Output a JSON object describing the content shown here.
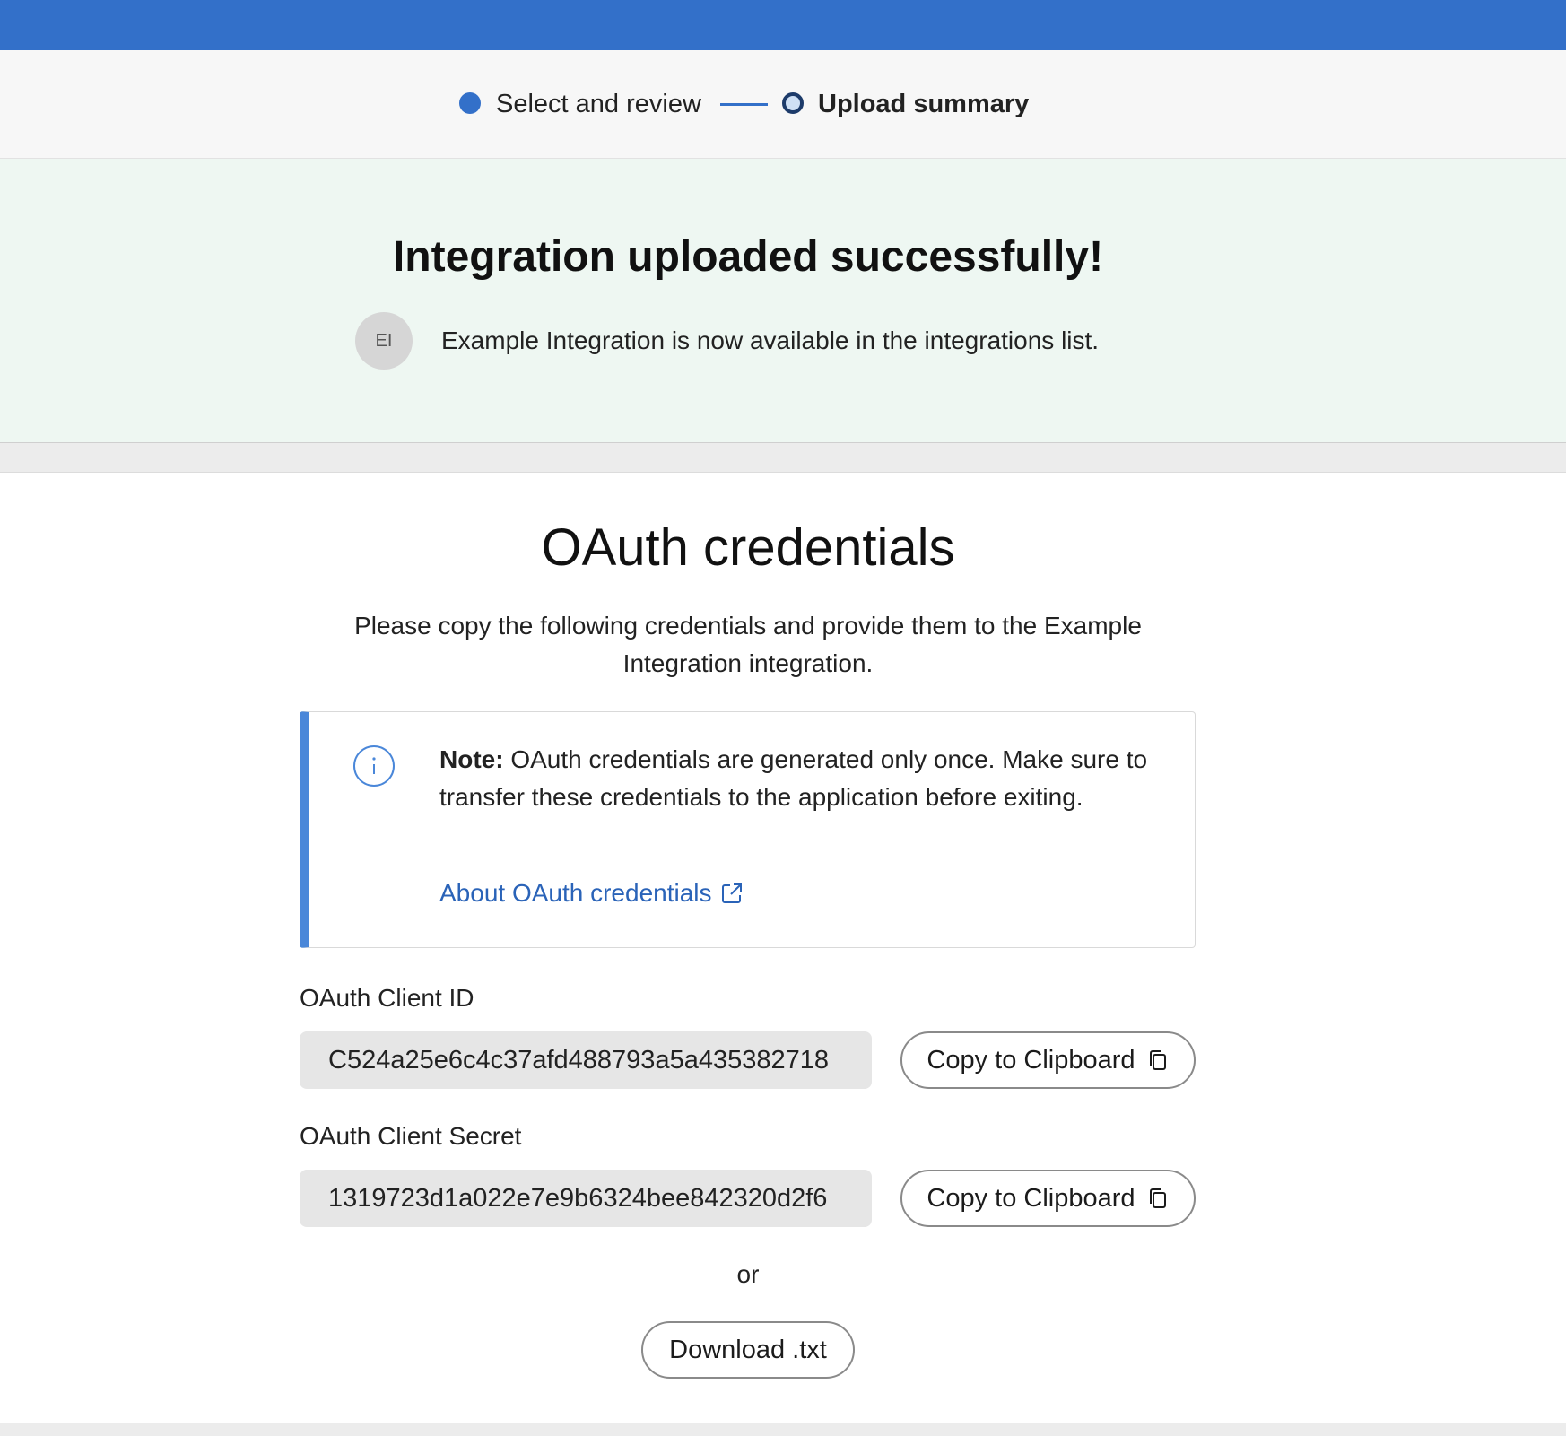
{
  "stepper": {
    "steps": [
      {
        "label": "Select and review",
        "state": "completed"
      },
      {
        "label": "Upload summary",
        "state": "current"
      }
    ]
  },
  "success": {
    "title": "Integration uploaded successfully!",
    "avatar_initials": "EI",
    "message": "Example Integration is now available in the integrations list."
  },
  "oauth": {
    "title": "OAuth credentials",
    "description": "Please copy the following credentials and provide them to the Example Integration integration.",
    "note": {
      "label": "Note:",
      "text": " OAuth credentials are generated only once. Make sure to transfer these credentials to the application before exiting.",
      "link_text": "About OAuth credentials",
      "icons": [
        "info-icon",
        "external-link-icon"
      ]
    },
    "client_id": {
      "label": "OAuth Client ID",
      "value": "C524a25e6c4c37afd488793a5a435382718",
      "button_label": "Copy to Clipboard"
    },
    "client_secret": {
      "label": "OAuth Client Secret",
      "value": "1319723d1a022e7e9b6324bee842320d2f6",
      "button_label": "Copy to Clipboard"
    },
    "or_text": "or",
    "download_label": "Download .txt"
  },
  "colors": {
    "brand_blue": "#3370c9",
    "success_bg": "#eef7f2",
    "note_accent": "#4a87d9",
    "link": "#2a63b8"
  }
}
